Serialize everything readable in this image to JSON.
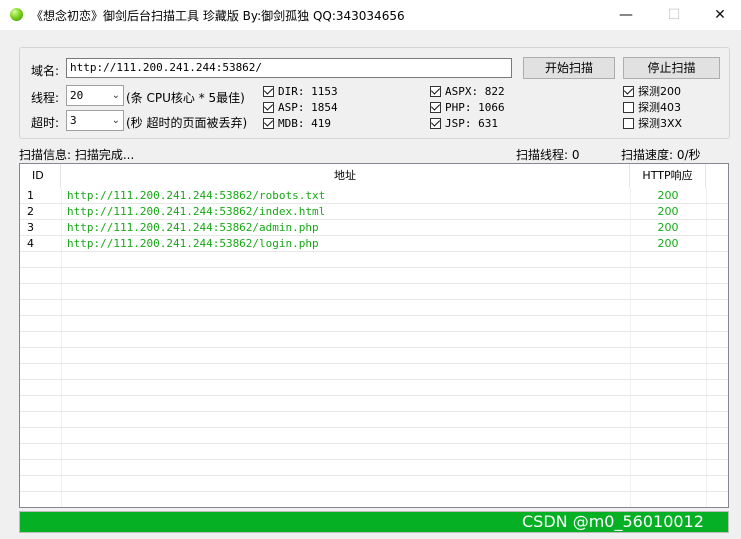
{
  "window": {
    "title": "《想念初恋》御剑后台扫描工具 珍藏版 By:御剑孤独 QQ:343034656",
    "minimize": "—",
    "maximize": "☐",
    "close": "✕"
  },
  "config": {
    "domain_label": "域名:",
    "domain_value": "http://111.200.241.244:53862/",
    "threads_label": "线程:",
    "threads_value": "20",
    "threads_hint": "(条 CPU核心 * 5最佳)",
    "timeout_label": "超时:",
    "timeout_value": "3",
    "timeout_hint": "(秒 超时的页面被丢弃)",
    "start_button": "开始扫描",
    "stop_button": "停止扫描"
  },
  "dictionaries": [
    {
      "label": "DIR: 1153",
      "checked": true
    },
    {
      "label": "ASP: 1854",
      "checked": true
    },
    {
      "label": "MDB: 419",
      "checked": true
    },
    {
      "label": "ASPX: 822",
      "checked": true
    },
    {
      "label": "PHP: 1066",
      "checked": true
    },
    {
      "label": "JSP: 631",
      "checked": true
    }
  ],
  "probes": [
    {
      "label": "探测200",
      "checked": true
    },
    {
      "label": "探测403",
      "checked": false
    },
    {
      "label": "探测3XX",
      "checked": false
    }
  ],
  "status": {
    "info": "扫描信息: 扫描完成...",
    "threads": "扫描线程: 0",
    "speed": "扫描速度: 0/秒"
  },
  "table": {
    "columns": [
      "ID",
      "地址",
      "HTTP响应"
    ],
    "rows": [
      {
        "id": "1",
        "url": "http://111.200.241.244:53862/robots.txt",
        "code": "200"
      },
      {
        "id": "2",
        "url": "http://111.200.241.244:53862/index.html",
        "code": "200"
      },
      {
        "id": "3",
        "url": "http://111.200.241.244:53862/admin.php",
        "code": "200"
      },
      {
        "id": "4",
        "url": "http://111.200.241.244:53862/login.php",
        "code": "200"
      }
    ],
    "empty_rows": 15,
    "result_color": "#17a817"
  },
  "progress": {
    "fraction": 1.0,
    "color": "#06b025"
  },
  "watermark": "CSDN @m0_56010012"
}
